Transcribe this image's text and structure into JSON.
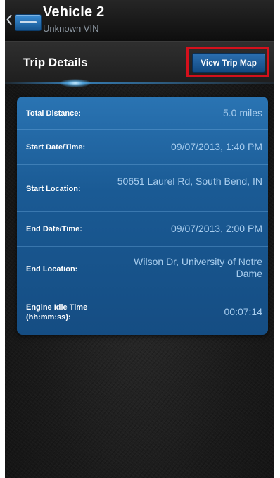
{
  "action_bar": {
    "title": "Vehicle 2",
    "subtitle": "Unknown VIN"
  },
  "header": {
    "title": "Trip Details",
    "view_trip_map_label": "View Trip Map",
    "highlight_color": "#d4101c"
  },
  "trip_details": {
    "rows": [
      {
        "label": "Total Distance:",
        "value": "5.0 miles"
      },
      {
        "label": "Start Date/Time:",
        "value": "09/07/2013, 1:40 PM"
      },
      {
        "label": "Start Location:",
        "value": "50651 Laurel Rd, South Bend, IN"
      },
      {
        "label": "End Date/Time:",
        "value": "09/07/2013, 2:00 PM"
      },
      {
        "label": "End Location:",
        "value": "Wilson Dr, University of Notre Dame"
      },
      {
        "label": "Engine Idle Time (hh:mm:ss):",
        "value": "00:07:14"
      }
    ]
  },
  "colors": {
    "accent_blue": "#1a5a94",
    "value_text": "#a8cdee"
  },
  "icons": {
    "back": "chevron-left-icon",
    "logo": "app-logo-icon"
  }
}
